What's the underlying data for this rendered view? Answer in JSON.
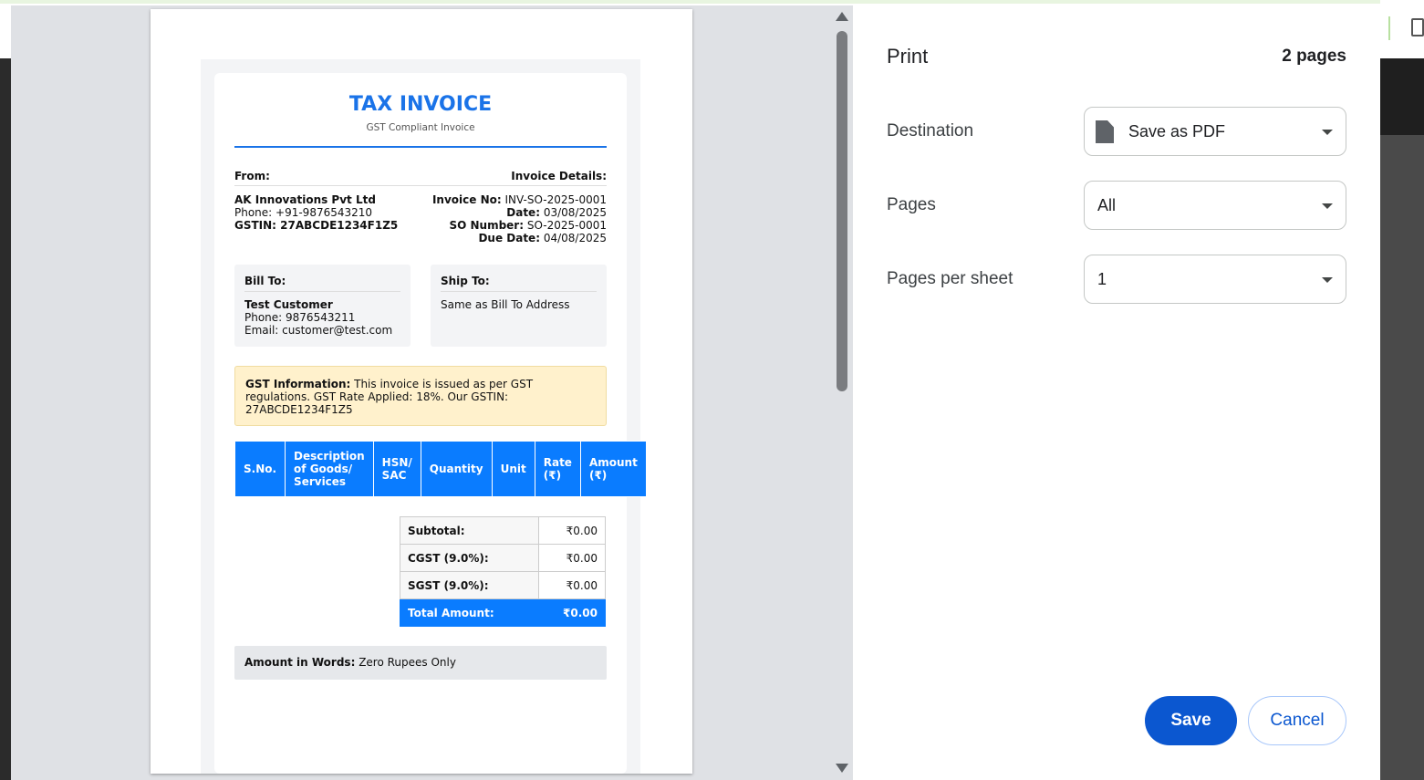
{
  "print": {
    "title": "Print",
    "page_count": "2 pages",
    "destination": {
      "label": "Destination",
      "value": "Save as PDF",
      "icon": "file-icon"
    },
    "pages": {
      "label": "Pages",
      "value": "All"
    },
    "pages_per_sheet": {
      "label": "Pages per sheet",
      "value": "1"
    },
    "save_label": "Save",
    "cancel_label": "Cancel"
  },
  "invoice": {
    "title": "TAX INVOICE",
    "subtitle": "GST Compliant Invoice",
    "from_heading": "From:",
    "details_heading": "Invoice Details:",
    "company_name": "AK Innovations Pvt Ltd",
    "company_phone": "Phone: +91-9876543210",
    "company_gstin": "GSTIN: 27ABCDE1234F1Z5",
    "details": [
      {
        "label": "Invoice No:",
        "value": "INV-SO-2025-0001"
      },
      {
        "label": "Date:",
        "value": "03/08/2025"
      },
      {
        "label": "SO Number:",
        "value": "SO-2025-0001"
      },
      {
        "label": "Due Date:",
        "value": "04/08/2025"
      }
    ],
    "bill_to": {
      "heading": "Bill To:",
      "name": "Test Customer",
      "phone": "Phone: 9876543211",
      "email": "Email: customer@test.com"
    },
    "ship_to": {
      "heading": "Ship To:",
      "text": "Same as Bill To Address"
    },
    "gst_info": {
      "label": "GST Information:",
      "text": "This invoice is issued as per GST regulations. GST Rate Applied: 18%. Our GSTIN: 27ABCDE1234F1Z5"
    },
    "table_headers": [
      "S.No.",
      "Description of Goods/ Services",
      "HSN/ SAC",
      "Quantity",
      "Unit",
      "Rate (₹)",
      "Amount (₹)"
    ],
    "totals": [
      {
        "label": "Subtotal:",
        "value": "₹0.00"
      },
      {
        "label": "CGST (9.0%):",
        "value": "₹0.00"
      },
      {
        "label": "SGST (9.0%):",
        "value": "₹0.00"
      },
      {
        "label": "Total Amount:",
        "value": "₹0.00"
      }
    ],
    "amount_words_label": "Amount in Words:",
    "amount_words_value": "Zero Rupees Only"
  },
  "colors": {
    "accent": "#0a7cff",
    "primary_button": "#0b57d0",
    "gst_box": "#fff1cc"
  }
}
